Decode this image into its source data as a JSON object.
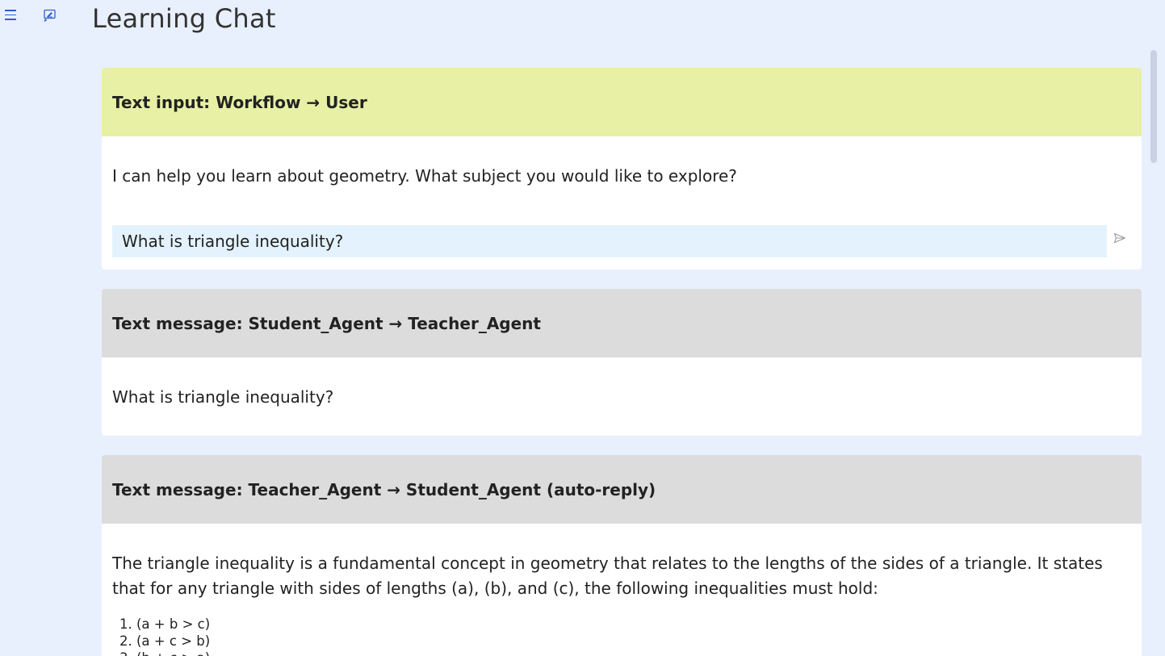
{
  "page": {
    "title": "Learning Chat"
  },
  "icons": {
    "menu": "hamburger-menu-icon",
    "new_chat": "edit-chat-icon",
    "send": "send-icon"
  },
  "cards": [
    {
      "kind": "text-input",
      "header": "Text input: Workflow → User",
      "prompt": "I can help you learn about geometry. What subject you would like to explore?",
      "reply_value": "What is triangle inequality?"
    },
    {
      "kind": "text-message",
      "header": "Text message: Student_Agent → Teacher_Agent",
      "text": "What is triangle inequality?"
    },
    {
      "kind": "text-message",
      "header": "Text message: Teacher_Agent → Student_Agent (auto-reply)",
      "text": "The triangle inequality is a fundamental concept in geometry that relates to the lengths of the sides of a triangle. It states that for any triangle with sides of lengths (a), (b), and (c), the following inequalities must hold:",
      "list": [
        "(a + b > c)",
        "(a + c > b)",
        "(b + c > a)"
      ]
    }
  ],
  "colors": {
    "page_bg": "#e9f0fd",
    "input_header": "#e7f0a5",
    "message_header": "#dcdcdc",
    "reply_field_bg": "#e3f2fc",
    "accent": "#2f5fd0"
  }
}
